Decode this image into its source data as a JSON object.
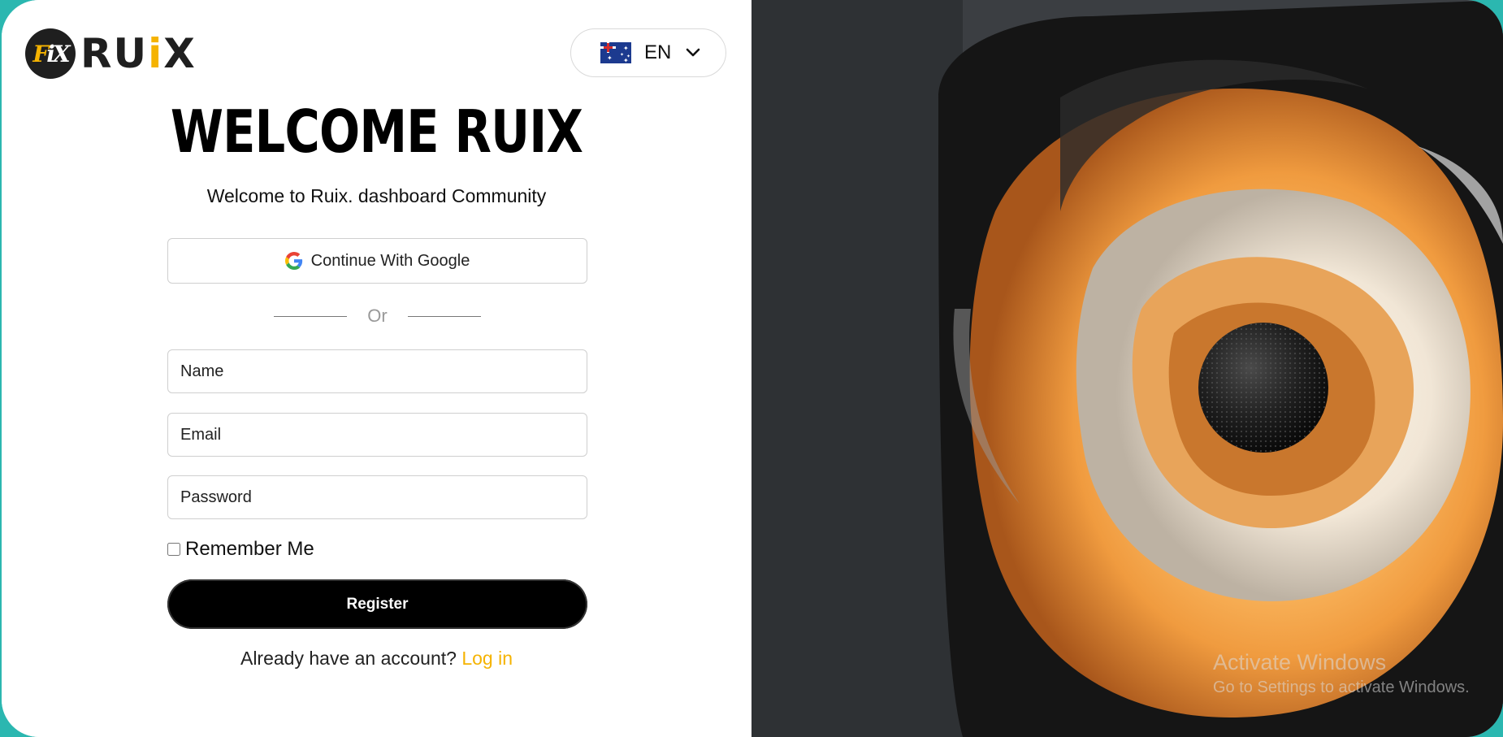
{
  "brand": {
    "badge_text": "FiX",
    "name_part1": "RU",
    "name_i": "i",
    "name_part2": "X",
    "accent": "#f5b301"
  },
  "language": {
    "code": "EN",
    "flag": "australia-flag-icon",
    "dropdown_icon": "chevron-down-icon"
  },
  "hero": {
    "title": "WELCOME RUIX",
    "subtitle": "Welcome to Ruix. dashboard Community"
  },
  "form": {
    "google_label": "Continue With Google",
    "google_icon": "google-g-icon",
    "divider_text": "Or",
    "name_placeholder": "Name",
    "email_placeholder": "Email",
    "password_placeholder": "Password",
    "remember_label": "Remember Me",
    "register_label": "Register",
    "login_prompt": "Already have an account?",
    "login_link": "Log in"
  },
  "watermark": {
    "line1": "Activate Windows",
    "line2": "Go to Settings to activate Windows."
  },
  "colors": {
    "background_teal": "#2bb7b0",
    "button_black": "#000000",
    "link_accent": "#f5b301"
  }
}
